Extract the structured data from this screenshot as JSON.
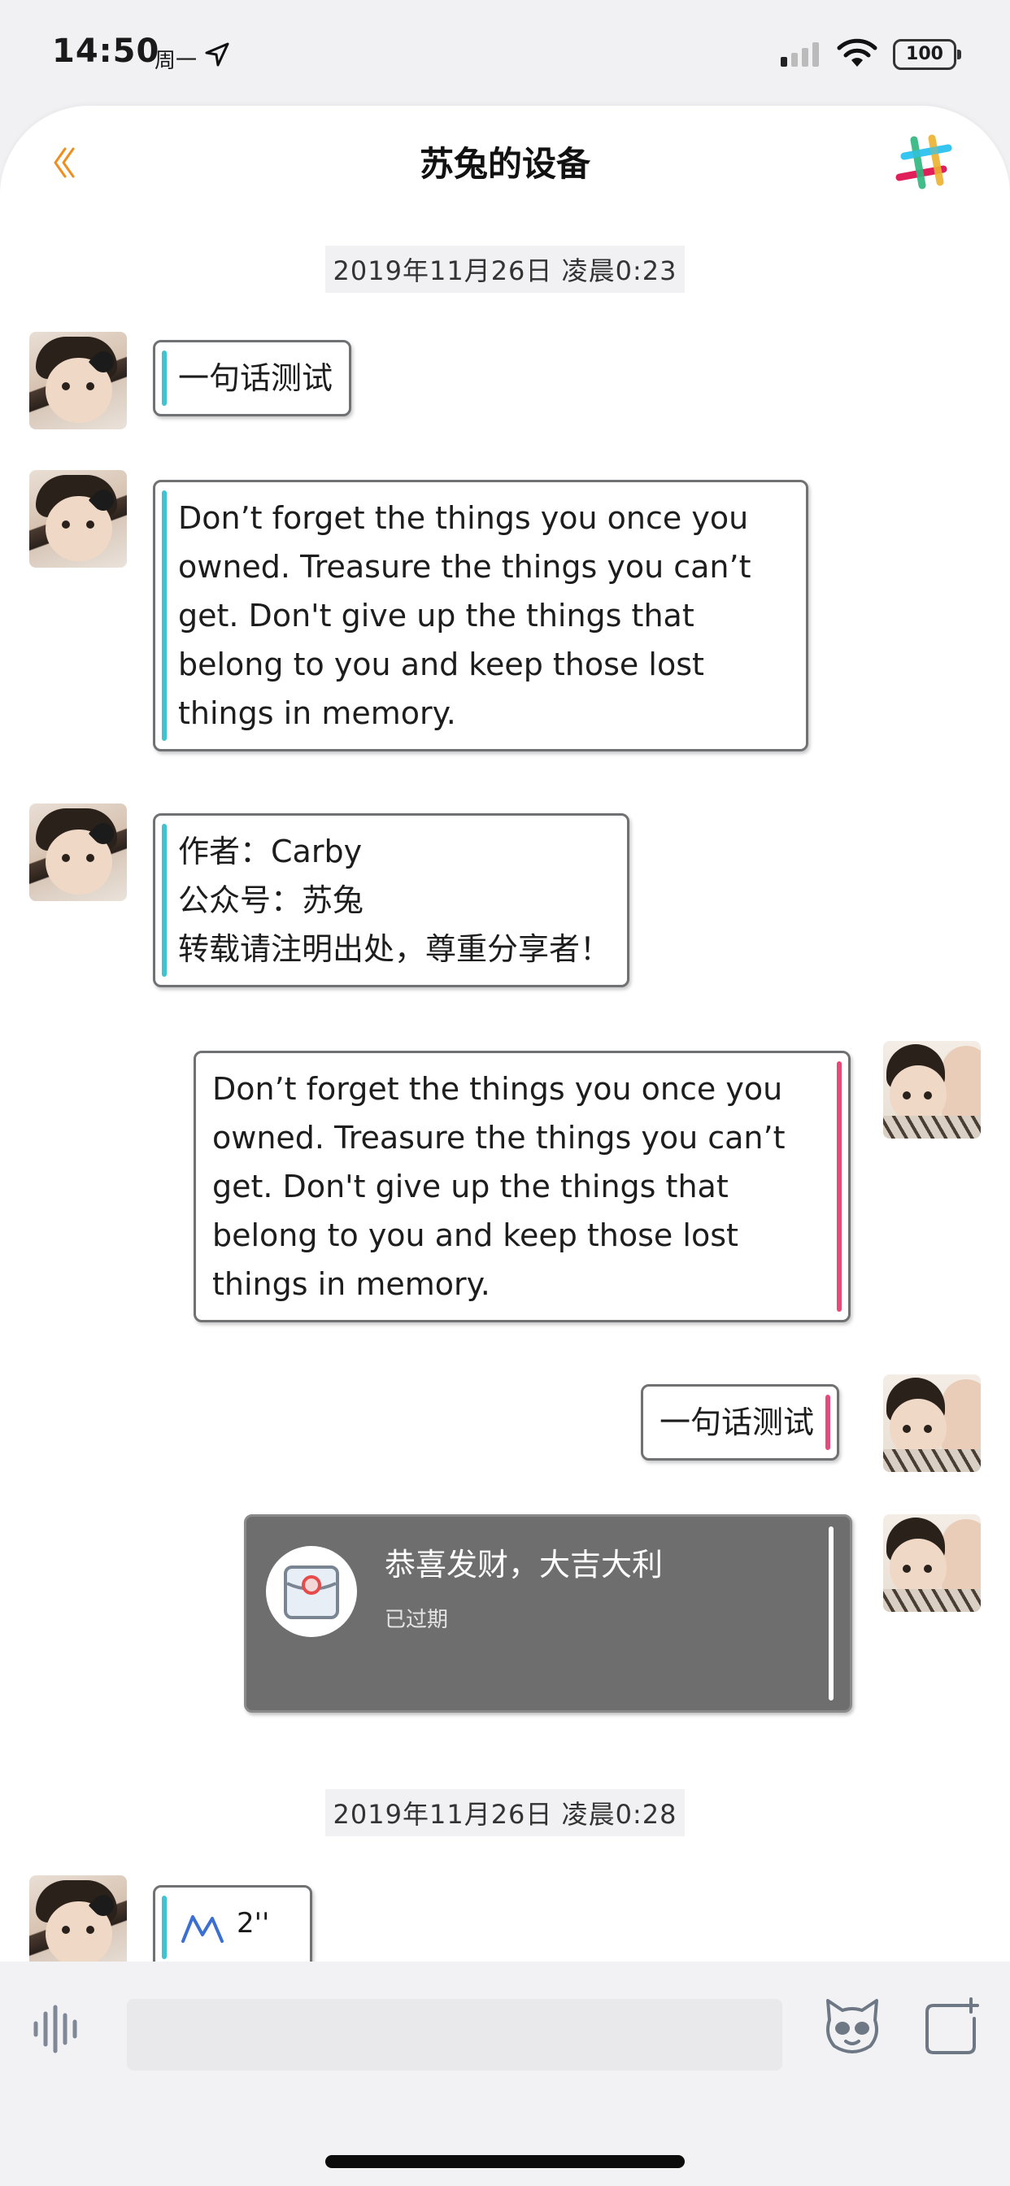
{
  "status_bar": {
    "time": "14:50",
    "weekday": "周一",
    "battery": "100"
  },
  "nav": {
    "title": "苏兔的设备",
    "back_icon": "chevron-left-double-icon",
    "accent_back": "#f28c1c"
  },
  "chat": {
    "timestamps": [
      "2019年11月26日 凌晨0:23",
      "2019年11月26日 凌晨0:28"
    ],
    "messages": [
      {
        "side": "left",
        "type": "text",
        "text": "一句话测试"
      },
      {
        "side": "left",
        "type": "text",
        "text": "Don’t forget the things you once you\nowned. Treasure the things you can’t\nget. Don't give up the things that\nbelong to you and keep those lost\nthings in memory."
      },
      {
        "side": "left",
        "type": "text",
        "text": "作者：Carby\n公众号：苏兔\n转载请注明出处，尊重分享者！"
      },
      {
        "side": "right",
        "type": "text",
        "text": "Don’t forget the things you once you\nowned. Treasure the things you can’t\nget. Don't give up the things that\nbelong to you and keep those lost\nthings in memory."
      },
      {
        "side": "right",
        "type": "text",
        "text": "一句话测试"
      },
      {
        "side": "right",
        "type": "red_packet",
        "title": "恭喜发财，大吉大利",
        "status": "已过期"
      },
      {
        "side": "left",
        "type": "voice",
        "duration": "2''"
      }
    ],
    "colors": {
      "left_accent": "#3fc3d3",
      "right_accent": "#e64a7a",
      "packet_bg": "#6e6e6e"
    }
  },
  "input": {
    "placeholder": "",
    "value": ""
  }
}
